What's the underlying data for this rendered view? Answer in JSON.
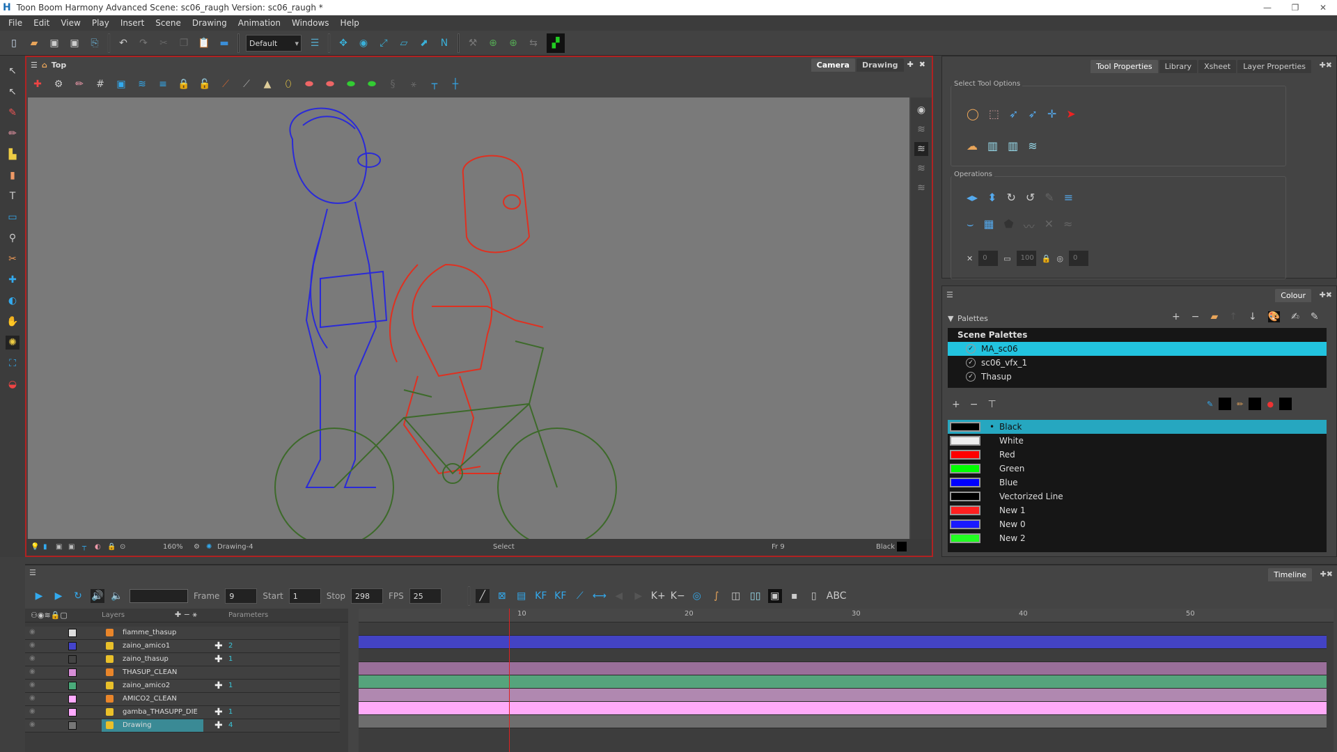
{
  "window": {
    "title": "Toon Boom Harmony Advanced Scene: sc06_raugh Version: sc06_raugh *",
    "app_icon": "H"
  },
  "menu": [
    "File",
    "Edit",
    "View",
    "Play",
    "Insert",
    "Scene",
    "Drawing",
    "Animation",
    "Windows",
    "Help"
  ],
  "toolbar": {
    "workspace": "Default"
  },
  "camera": {
    "breadcrumb": "Top",
    "tabs": [
      "Camera",
      "Drawing"
    ],
    "zoom": "160%",
    "drawing": "Drawing-4",
    "tool": "Select",
    "frame": "Fr 9",
    "colour": "Black"
  },
  "tool_properties": {
    "tabs": [
      "Tool Properties",
      "Library",
      "Xsheet",
      "Layer Properties"
    ],
    "select_options_label": "Select Tool Options",
    "operations_label": "Operations",
    "width": "0",
    "height": "100",
    "angle": "0"
  },
  "colour": {
    "tab": "Colour",
    "palettes_label": "Palettes",
    "scene_palettes_label": "Scene Palettes",
    "palettes": [
      {
        "name": "MA_sc06",
        "selected": true
      },
      {
        "name": "sc06_vfx_1"
      },
      {
        "name": "Thasup"
      }
    ],
    "swatches": [
      {
        "name": "Black",
        "color": "#000000",
        "selected": true
      },
      {
        "name": "White",
        "color": "#eeeeee"
      },
      {
        "name": "Red",
        "color": "#ff0000"
      },
      {
        "name": "Green",
        "color": "#00ff00"
      },
      {
        "name": "Blue",
        "color": "#0000ff"
      },
      {
        "name": "Vectorized Line",
        "color": "#000000"
      },
      {
        "name": "New 1",
        "color": "#ff2020"
      },
      {
        "name": "New 0",
        "color": "#1a1aff"
      },
      {
        "name": "New 2",
        "color": "#22ff22"
      }
    ]
  },
  "timeline": {
    "tab": "Timeline",
    "frame_label": "Frame",
    "frame": "9",
    "start_label": "Start",
    "start": "1",
    "stop_label": "Stop",
    "stop": "298",
    "fps_label": "FPS",
    "fps": "25",
    "layers_label": "Layers",
    "parameters_label": "Parameters",
    "ruler": [
      "10",
      "20",
      "30",
      "40",
      "50"
    ],
    "current_frame": 9,
    "layers": [
      {
        "name": "fiamme_thasup",
        "color": "#dddddd",
        "type": "group",
        "params": "",
        "track": "#3d3d3d"
      },
      {
        "name": "zaino_amico1",
        "color": "#4444cc",
        "type": "drawing",
        "params": "2",
        "track": "#4343c4"
      },
      {
        "name": "zaino_thasup",
        "color": "#444444",
        "type": "drawing",
        "params": "1",
        "track": "#3d3d3d"
      },
      {
        "name": "THASUP_CLEAN",
        "color": "#d88ed8",
        "type": "group",
        "params": "",
        "track": "#9a6f9a"
      },
      {
        "name": "zaino_amico2",
        "color": "#4aaa7a",
        "type": "drawing",
        "params": "1",
        "track": "#55a47c"
      },
      {
        "name": "AMICO2_CLEAN",
        "color": "#ffaaff",
        "type": "group",
        "params": "",
        "track": "#b088b0"
      },
      {
        "name": "gamba_THASUPP_DIE",
        "color": "#ffaaff",
        "type": "drawing",
        "params": "1",
        "track": "#ffaaf8"
      },
      {
        "name": "Drawing",
        "color": "#777777",
        "type": "drawing",
        "params": "4",
        "track": "#6e6e6e",
        "selected": true
      }
    ]
  }
}
